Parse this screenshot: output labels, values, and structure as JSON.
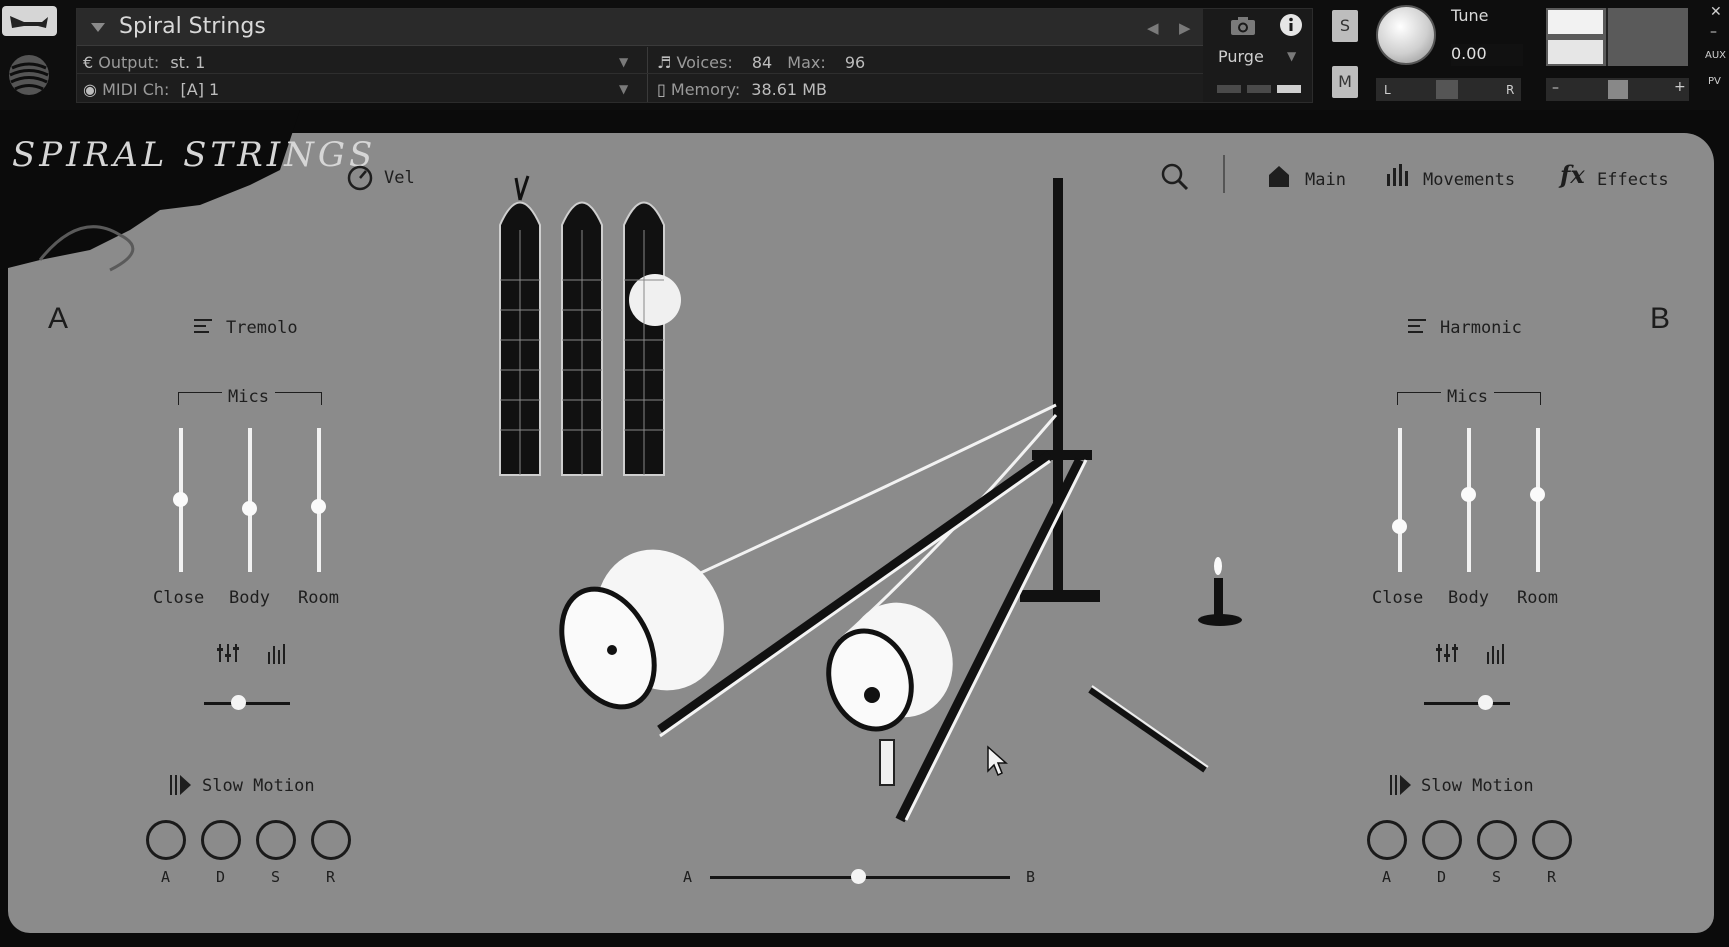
{
  "header": {
    "instrument_name": "Spiral Strings",
    "output_label": "Output:",
    "output_value": "st. 1",
    "midi_label": "MIDI Ch:",
    "midi_value": "[A]  1",
    "voices_label": "Voices:",
    "voices_value": "84",
    "max_label": "Max:",
    "max_value": "96",
    "memory_label": "Memory:",
    "memory_value": "38.61 MB",
    "purge_label": "Purge",
    "solo_label": "S",
    "mute_label": "M",
    "tune_label": "Tune",
    "tune_value": "0.00",
    "pan_left": "L",
    "pan_right": "R",
    "vol_minus": "–",
    "vol_plus": "+",
    "aux_label": "AUX",
    "pv_label": "PV",
    "close_glyph": "✕",
    "min_glyph": "–"
  },
  "instrument": {
    "brand": "SPIRAL STRINGS",
    "vel_label": "Vel",
    "nav": {
      "main": "Main",
      "movements": "Movements",
      "effects": "Effects"
    },
    "side_a": {
      "letter": "A",
      "articulation": "Tremolo",
      "mics_title": "Mics",
      "faders": [
        {
          "label": "Close",
          "level": 0.5
        },
        {
          "label": "Body",
          "level": 0.44
        },
        {
          "label": "Room",
          "level": 0.45
        }
      ],
      "pan_level": 0.4,
      "slow_motion": "Slow Motion",
      "adsr": [
        "A",
        "D",
        "S",
        "R"
      ]
    },
    "side_b": {
      "letter": "B",
      "articulation": "Harmonic",
      "mics_title": "Mics",
      "faders": [
        {
          "label": "Close",
          "level": 0.3
        },
        {
          "label": "Body",
          "level": 0.54
        },
        {
          "label": "Room",
          "level": 0.54
        }
      ],
      "pan_level": 0.7,
      "slow_motion": "Slow Motion",
      "adsr": [
        "A",
        "D",
        "S",
        "R"
      ]
    },
    "crossfade": {
      "left": "A",
      "right": "B",
      "level": 0.5
    }
  }
}
